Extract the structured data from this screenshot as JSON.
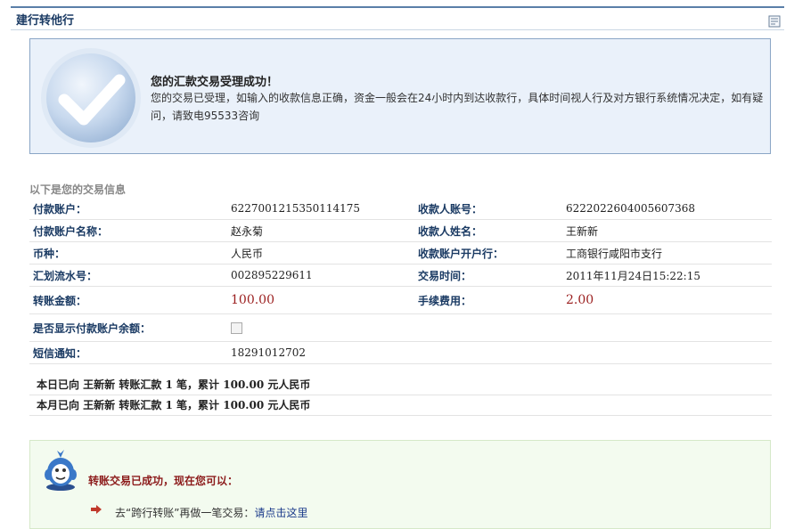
{
  "page": {
    "title": "建行转他行"
  },
  "success": {
    "heading": "您的汇款交易受理成功！",
    "message": "您的交易已受理，如输入的收款信息正确，资金一般会在24小时内到达收款行，具体时间视人行及对方银行系统情况决定，如有疑问，请致电95533咨询"
  },
  "info": {
    "caption": "以下是您的交易信息",
    "rows": [
      {
        "label1": "付款账户：",
        "value1": "6227001215350114175",
        "label2": "收款人账号：",
        "value2": "6222022604005607368"
      },
      {
        "label1": "付款账户名称：",
        "value1": "赵永菊",
        "label2": "收款人姓名：",
        "value2": "王新新"
      },
      {
        "label1": "币种：",
        "value1": "人民币",
        "label2": "收款账户开户行：",
        "value2": "工商银行咸阳市支行"
      },
      {
        "label1": "汇划流水号：",
        "value1": "002895229611",
        "label2": "交易时间：",
        "value2": "2011年11月24日15:22:15"
      },
      {
        "label1": "转账金额：",
        "value1": "100.00",
        "label2": "手续费用：",
        "value2": "2.00"
      }
    ],
    "show_balance_label": "是否显示付款账户余额：",
    "show_balance_checked": false,
    "sms_label": "短信通知：",
    "sms_value": "18291012702"
  },
  "summary": {
    "daily": "本日已向 王新新 转账汇款 1 笔，累计 100.00 元人民币",
    "monthly": "本月已向 王新新 转账汇款 1 笔，累计 100.00 元人民币"
  },
  "next": {
    "title": "转账交易已成功，现在您可以：",
    "item_text": "去“跨行转账”再做一笔交易：",
    "item_link": "请点击这里"
  },
  "colors": {
    "accent": "#1a3a63",
    "money": "#9b1f1f",
    "success_bg": "#eaf1fa",
    "next_bg": "#f3fbef"
  }
}
